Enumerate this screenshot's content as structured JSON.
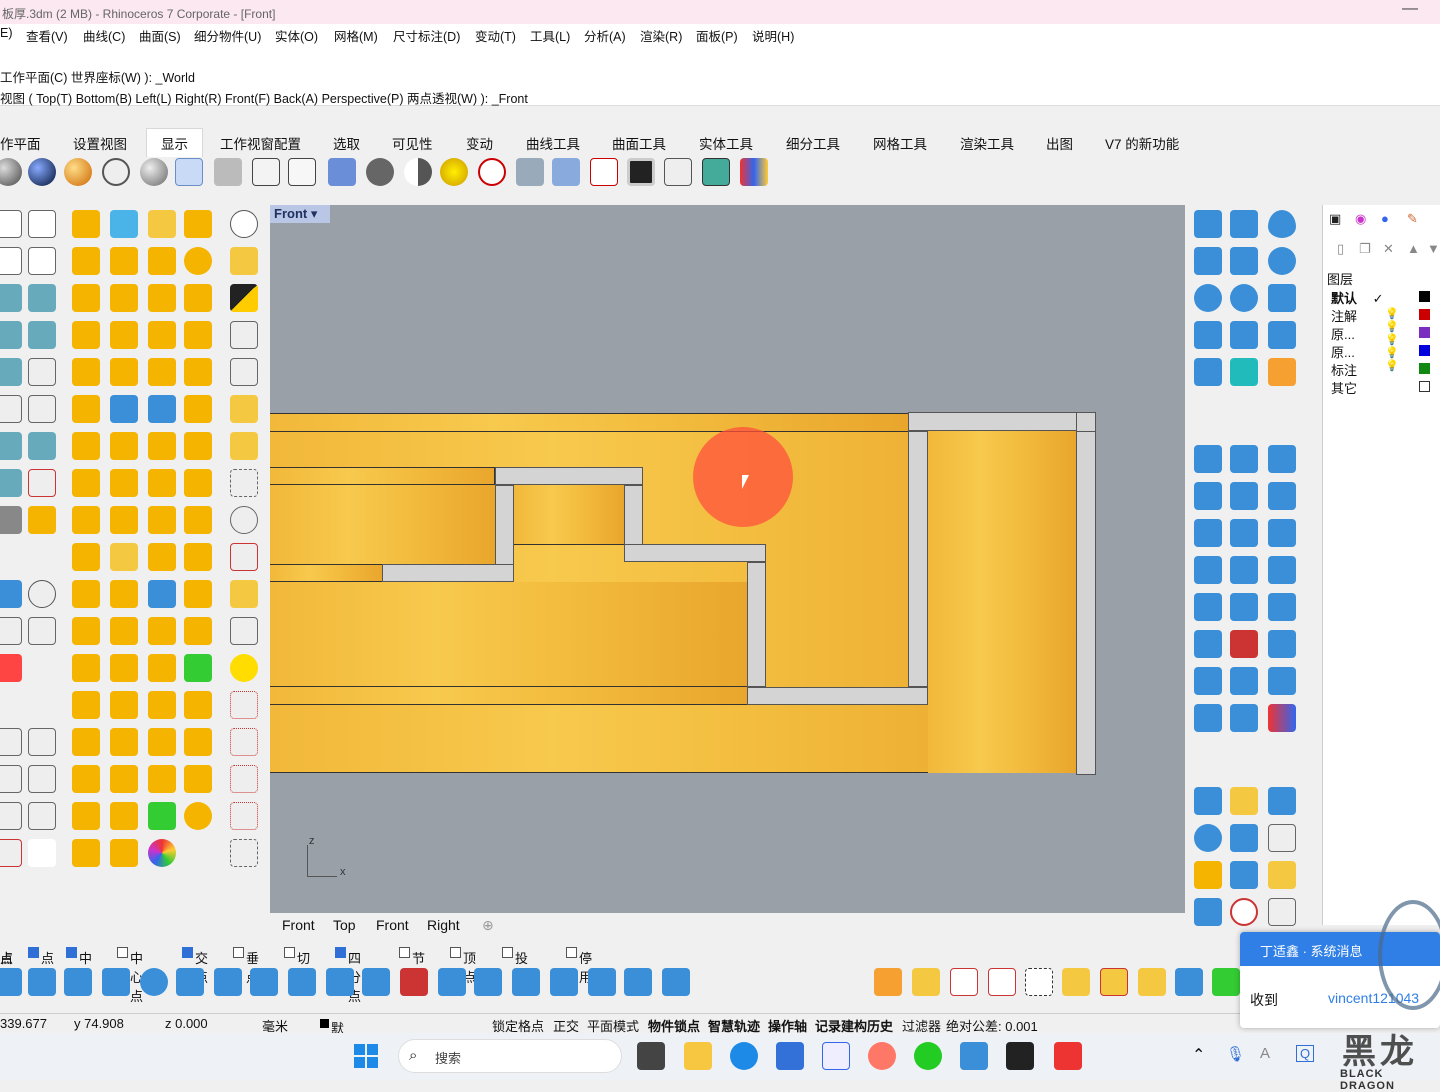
{
  "window": {
    "title": "板厚.3dm (2 MB) - Rhinoceros 7 Corporate - [Front]",
    "minimize": "—"
  },
  "menu": [
    "E)",
    "查看(V)",
    "曲线(C)",
    "曲面(S)",
    "细分物件(U)",
    "实体(O)",
    "网格(M)",
    "尺寸标注(D)",
    "变动(T)",
    "工具(L)",
    "分析(A)",
    "渲染(R)",
    "面板(P)",
    "说明(H)"
  ],
  "command": {
    "line1": "工作平面(C)  世界座标(W) ): _World",
    "line2": "视图 ( Top(T)  Bottom(B)  Left(L)  Right(R)  Front(F)  Back(A)  Perspective(P)  两点透视(W) ): _Front"
  },
  "tabs": [
    "作平面",
    "设置视图",
    "显示",
    "工作视窗配置",
    "选取",
    "可见性",
    "变动",
    "曲线工具",
    "曲面工具",
    "实体工具",
    "细分工具",
    "网格工具",
    "渲染工具",
    "出图",
    "V7 的新功能"
  ],
  "active_tab": "显示",
  "viewport": {
    "name": "Front",
    "axis_z": "z",
    "axis_x": "x"
  },
  "viewport_tabs": [
    "Front",
    "Top",
    "Front",
    "Right"
  ],
  "layers": {
    "header": "图层",
    "items": [
      {
        "name": "默认",
        "color": "#000000"
      },
      {
        "name": "注解",
        "color": "#cc0000"
      },
      {
        "name": "原...",
        "color": "#7a2fc0"
      },
      {
        "name": "原...",
        "color": "#0000dd"
      },
      {
        "name": "标注",
        "color": "#118811"
      },
      {
        "name": "其它",
        "color": "#ffffff"
      }
    ],
    "check": "✓"
  },
  "osnap": [
    {
      "label": "点",
      "on": false,
      "prefix": "占"
    },
    {
      "label": "点",
      "on": true
    },
    {
      "label": "中点",
      "on": true
    },
    {
      "label": "中心点",
      "on": false
    },
    {
      "label": "交点",
      "on": true
    },
    {
      "label": "垂点",
      "on": false
    },
    {
      "label": "切点",
      "on": false
    },
    {
      "label": "四分点",
      "on": true
    },
    {
      "label": "节点",
      "on": false
    },
    {
      "label": "顶点",
      "on": false
    },
    {
      "label": "投影",
      "on": false
    },
    {
      "label": "停用",
      "on": false
    }
  ],
  "status": {
    "x": "339.677",
    "y": "y 74.908",
    "z": "z 0.000",
    "unit": "毫米",
    "layer": "默认",
    "items": [
      "锁定格点",
      "正交",
      "平面模式",
      "物件锁点",
      "智慧轨迹",
      "操作轴",
      "记录建构历史",
      "过滤器",
      "绝对公差: 0.001"
    ]
  },
  "notification": {
    "title": "丁适鑫 · 系统消息",
    "label": "收到",
    "user": "vincent121043"
  },
  "taskbar": {
    "search_placeholder": "搜索"
  },
  "watermark": {
    "text": "黑龙",
    "sub": "BLACK DRAGON"
  }
}
